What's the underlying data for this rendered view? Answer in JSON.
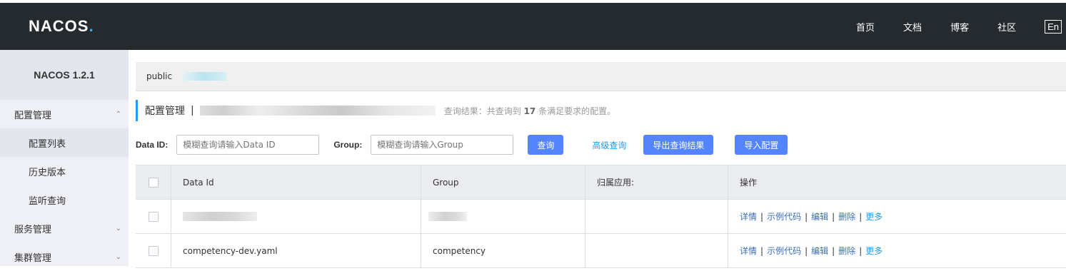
{
  "header": {
    "logo_text": "NACOS",
    "logo_dot": ".",
    "nav": [
      "首页",
      "文档",
      "博客",
      "社区"
    ],
    "lang": "En"
  },
  "sidebar": {
    "version": "NACOS 1.2.1",
    "groups": [
      {
        "label": "配置管理",
        "expanded": true,
        "items": [
          "配置列表",
          "历史版本",
          "监听查询"
        ]
      },
      {
        "label": "服务管理",
        "expanded": false
      },
      {
        "label": "集群管理",
        "expanded": false
      }
    ],
    "active_item": "配置列表"
  },
  "main": {
    "namespace": "public",
    "title": "配置管理",
    "separator": "|",
    "result_prefix": "查询结果：共查询到",
    "result_count": "17",
    "result_suffix": "条满足要求的配置。",
    "filters": {
      "data_id_label": "Data ID:",
      "data_id_placeholder": "模糊查询请输入Data ID",
      "group_label": "Group:",
      "group_placeholder": "模糊查询请输入Group",
      "search_button": "查询",
      "advanced_link": "高级查询",
      "export_button": "导出查询结果",
      "import_button": "导入配置"
    },
    "table": {
      "headers": [
        "Data Id",
        "Group",
        "归属应用:",
        "操作"
      ],
      "ops": [
        "详情",
        "示例代码",
        "编辑",
        "删除",
        "更多"
      ],
      "rows": [
        {
          "data_id": "",
          "group": "",
          "app": ""
        },
        {
          "data_id": "competency-dev.yaml",
          "group": "competency",
          "app": ""
        }
      ]
    }
  },
  "colors": {
    "topbar": "#252a2f",
    "primary_button": "#5584ff",
    "link": "#209bfa",
    "op_link": "#3a6fb7"
  }
}
